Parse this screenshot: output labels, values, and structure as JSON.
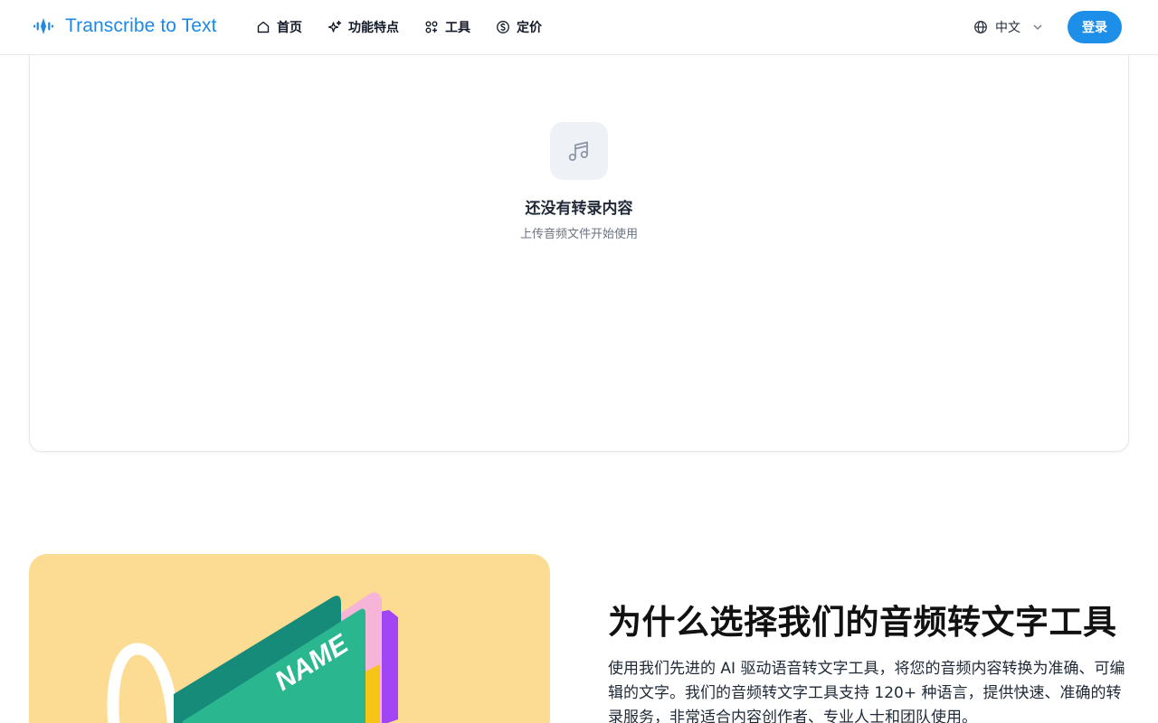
{
  "header": {
    "logo_text": "Transcribe to Text",
    "nav": [
      {
        "label": "首页",
        "icon": "home-icon"
      },
      {
        "label": "功能特点",
        "icon": "sparkles-icon"
      },
      {
        "label": "工具",
        "icon": "tools-icon"
      },
      {
        "label": "定价",
        "icon": "dollar-circle-icon"
      }
    ],
    "language": "中文",
    "login_label": "登录"
  },
  "transcript": {
    "empty_title": "还没有转录内容",
    "empty_subtitle": "上传音频文件开始使用",
    "empty_icon": "music-note-icon"
  },
  "why": {
    "title": "为什么选择我们的音频转文字工具",
    "body": "使用我们先进的 AI 驱动语音转文字工具，将您的音频内容转换为准确、可编辑的文字。我们的音频转文字工具支持 120+ 种语言，提供快速、准确的转录服务，非常适合内容创作者、专业人士和团队使用。",
    "illustration_label": "NAME"
  },
  "colors": {
    "brand": "#1e88e5",
    "login_bg": "#1e8fe8",
    "illustration_bg": "#fcdc93"
  }
}
